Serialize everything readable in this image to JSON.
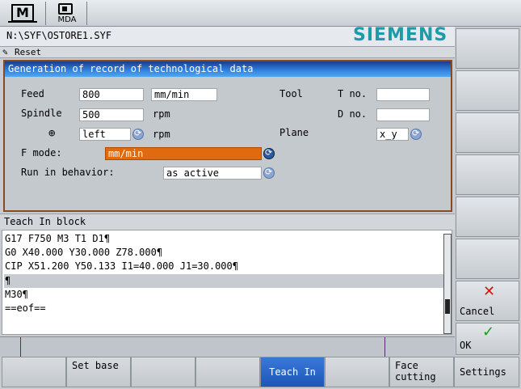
{
  "modes": {
    "m_label": "M",
    "mda_label": "MDA"
  },
  "header": {
    "path": "N:\\SYF\\OSTORE1.SYF",
    "logo": "SIEMENS",
    "status": "Reset"
  },
  "dialog": {
    "title": "Generation of record of technological data",
    "feed_label": "Feed",
    "feed_value": "800",
    "feed_unit": "mm/min",
    "spindle_label": "Spindle",
    "spindle_value": "500",
    "spindle_unit": "rpm",
    "direction_value": "left",
    "direction_unit": "rpm",
    "tool_label": "Tool",
    "tno_label": "T no.",
    "tno_value": "",
    "dno_label": "D no.",
    "dno_value": "",
    "plane_label": "Plane",
    "plane_value": "x_y",
    "fmode_label": "F mode:",
    "fmode_value": "mm/min",
    "runin_label": "Run in behavior:",
    "runin_value": "as active"
  },
  "teach": {
    "header": "Teach In block",
    "lines": [
      "G17 F750 M3 T1 D1¶",
      "G0 X40.000 Y30.000 Z78.000¶",
      "CIP X51.200 Y50.133 I1=40.000 J1=30.000¶",
      "¶",
      "M30¶",
      "==eof=="
    ]
  },
  "softkeys_bottom": [
    "",
    "Set base",
    "",
    "",
    "Teach In",
    "",
    "Face cutting",
    "Settings"
  ],
  "softkeys_right": {
    "cancel": "Cancel",
    "ok": "OK"
  },
  "colors": {
    "accent": "#2f7fe0",
    "highlight": "#e06a10",
    "logo": "#1e9aa8",
    "frame": "#8a4a1e"
  },
  "icons": {
    "cancel": "red-x-icon",
    "ok": "green-check-icon",
    "reset": "pencil-icon",
    "direction": "crosshair-icon"
  }
}
